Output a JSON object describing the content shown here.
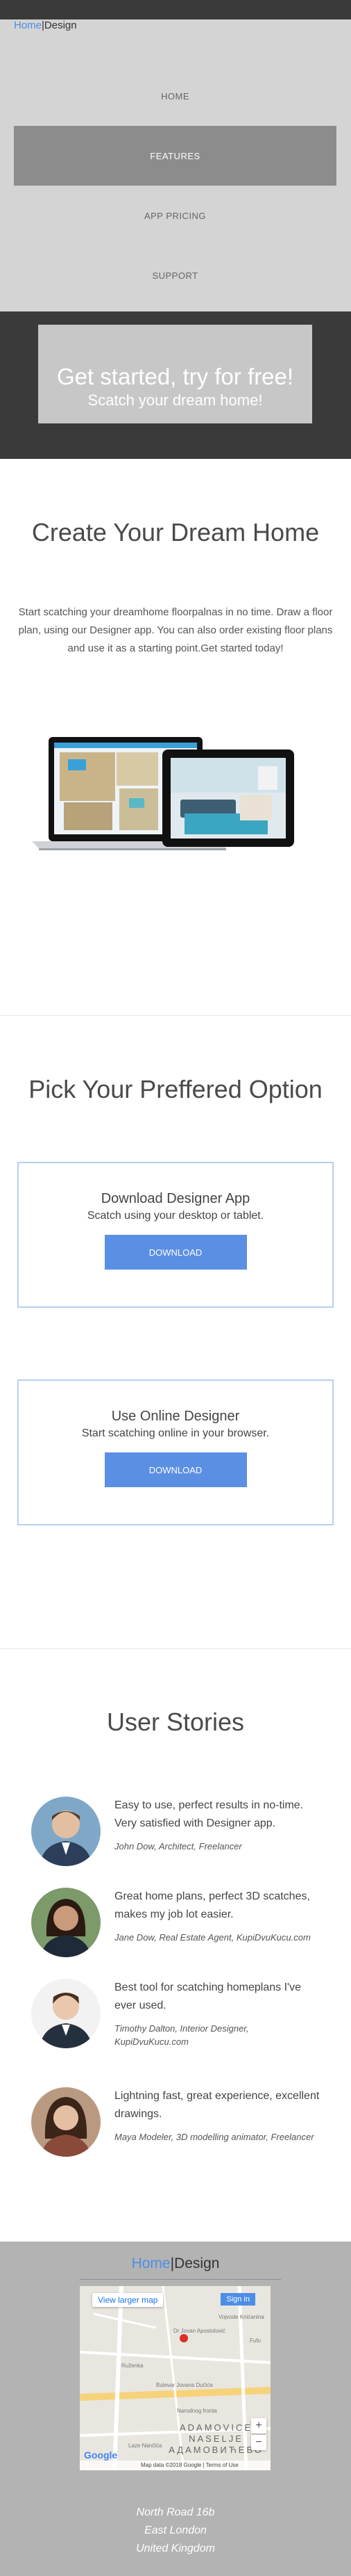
{
  "brand": {
    "home": "Home",
    "sep": "|",
    "design": "Design"
  },
  "nav": {
    "items": [
      "HOME",
      "FEATURES",
      "APP PRICING",
      "SUPPORT"
    ],
    "active": "FEATURES"
  },
  "cta": {
    "line1": "Get started, try for free!",
    "line2": "Scatch your dream home!"
  },
  "intro": {
    "title": "Create Your Dream Home",
    "text": "Start scatching your dreamhome floorpalnas in no time. Draw a floor plan, using our Designer app. You can also order existing floor plans and use it as a starting point.Get started today!"
  },
  "options": {
    "title": "Pick Your Preffered Option",
    "cards": [
      {
        "title": "Download Designer App",
        "subtitle": "Scatch using your desktop or tablet.",
        "button": "DOWNLOAD"
      },
      {
        "title": "Use Online Designer",
        "subtitle": "Start scatching online in your browser.",
        "button": "DOWNLOAD"
      }
    ]
  },
  "stories": {
    "title": "User Stories",
    "items": [
      {
        "quote": "Easy to use, perfect results in no-time. Very satisfied with Designer app.",
        "author": "John Dow, Architect, Freelancer"
      },
      {
        "quote": "Great home plans, perfect 3D scatches, makes my job lot easier.",
        "author": "Jane Dow, Real Estate Agent, KupiDvuKucu.com"
      },
      {
        "quote": "Best tool for scatching homeplans I've ever used.",
        "author": "Timothy Dalton, Interior Designer, KupiDvuKucu.com"
      },
      {
        "quote": "Lightning fast, great experience, excellent drawings.",
        "author": "Maya Modeler, 3D modelling animator, Freelancer"
      }
    ]
  },
  "footer": {
    "map": {
      "view_larger": "View larger map",
      "sign_in": "Sign in",
      "zoom_in": "+",
      "zoom_out": "−",
      "google": "Google",
      "attribution": "Map data ©2018 Google | Terms of Use",
      "area": "ADAMOVICE NASELJE",
      "area_cyr": "АДАМОВИЋЕВО",
      "street_labels": [
        "Dr Jovan Apostolović",
        "Fufu",
        "Bulevar Jovana Dučića",
        "Laze Nančića",
        "Ruženka",
        "Narodnog fronta",
        "Vojvode Knićanina"
      ]
    },
    "address": [
      "North Road 16b",
      "East London",
      "United Kingdom"
    ]
  },
  "colors": {
    "accent": "#4c8ee6",
    "button": "#5b8fe3",
    "nav_bg": "#d4d4d4",
    "nav_active": "#8c8c8c",
    "hero_bg": "#3a3a3a",
    "footer_bg": "#b3b3b3"
  }
}
